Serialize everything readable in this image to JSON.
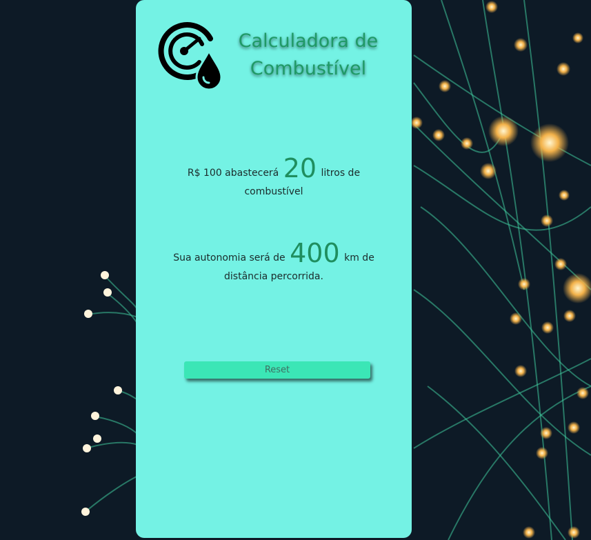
{
  "app": {
    "title_line1": "Calculadora de",
    "title_line2": "Combustível"
  },
  "icons": {
    "logo": "speedometer-fuel-drop-icon"
  },
  "result": {
    "line1_prefix": "R$ 100 abastecerá",
    "liters": "20",
    "line1_suffix": "litros de combustível",
    "line2_prefix": "Sua autonomia será de",
    "km": "400",
    "line2_suffix": "km de distância percorrida."
  },
  "actions": {
    "reset_label": "Reset"
  },
  "colors": {
    "card": "#74f2e4",
    "accent": "#1f9a66",
    "button": "#3be6b6",
    "background": "#0d1a26"
  }
}
